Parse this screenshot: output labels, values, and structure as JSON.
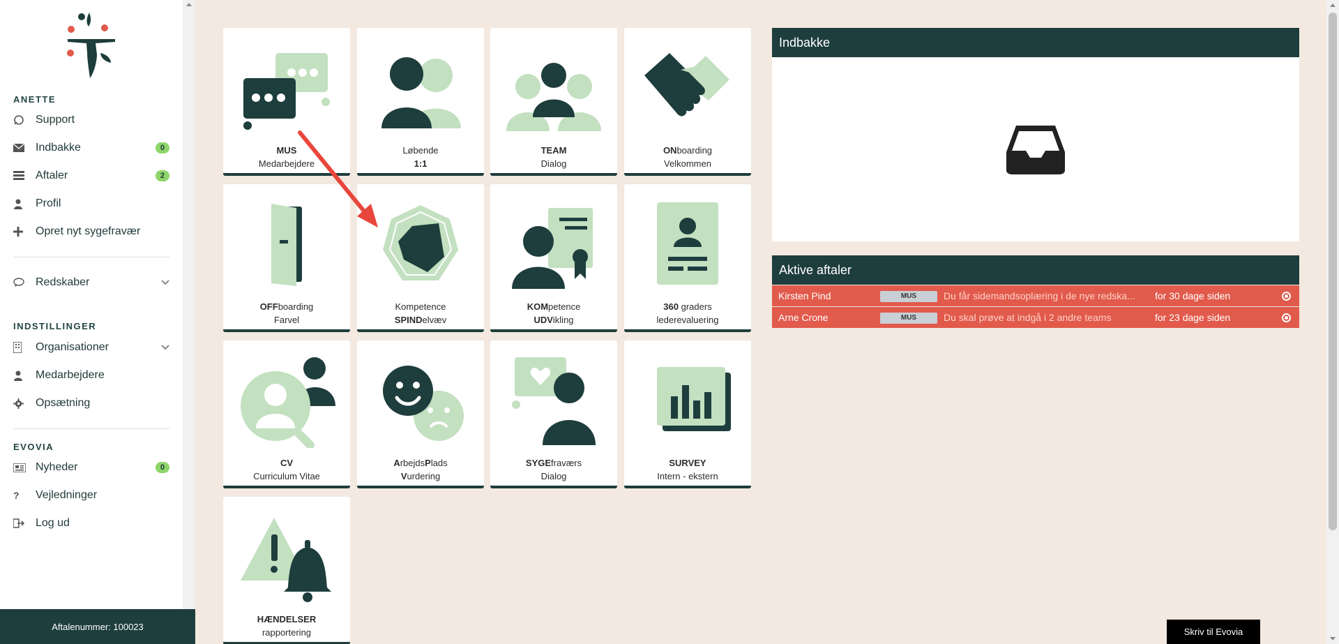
{
  "sidebar": {
    "user_section": "ANETTE",
    "items": [
      {
        "label": "Support",
        "icon": "support-icon"
      },
      {
        "label": "Indbakke",
        "icon": "envelope-icon",
        "badge": "0"
      },
      {
        "label": "Aftaler",
        "icon": "list-icon",
        "badge": "2"
      },
      {
        "label": "Profil",
        "icon": "user-icon"
      },
      {
        "label": "Opret nyt sygefravær",
        "icon": "plus-icon"
      }
    ],
    "tools": {
      "label": "Redskaber",
      "icon": "chat-bubble-icon"
    },
    "settings_section": "INDSTILLINGER",
    "settings_items": [
      {
        "label": "Organisationer",
        "icon": "building-icon"
      },
      {
        "label": "Medarbejdere",
        "icon": "user-icon"
      },
      {
        "label": "Opsætning",
        "icon": "gear-icon"
      }
    ],
    "evovia_section": "EVOVIA",
    "evovia_items": [
      {
        "label": "Nyheder",
        "icon": "newspaper-icon",
        "badge": "0"
      },
      {
        "label": "Vejledninger",
        "icon": "question-icon"
      },
      {
        "label": "Log ud",
        "icon": "logout-icon"
      }
    ],
    "footer": "Aftalenummer: 100023"
  },
  "tiles": [
    {
      "bold1": "MUS",
      "rest1": "",
      "bold2": "",
      "rest2": "Medarbejdere"
    },
    {
      "bold1": "",
      "rest1": "Løbende",
      "bold2": "1:1",
      "rest2": ""
    },
    {
      "bold1": "TEAM",
      "rest1": "",
      "bold2": "",
      "rest2": "Dialog"
    },
    {
      "bold1": "ON",
      "rest1": "boarding",
      "bold2": "",
      "rest2": "Velkommen"
    },
    {
      "bold1": "OFF",
      "rest1": "boarding",
      "bold2": "",
      "rest2": "Farvel"
    },
    {
      "bold1": "",
      "rest1": "Kompetence",
      "bold2": "SPIND",
      "rest2": "elvæv"
    },
    {
      "bold1": "KOM",
      "rest1": "petence",
      "bold2": "UDV",
      "rest2": "ikling"
    },
    {
      "bold1": "360",
      "rest1": " graders",
      "bold2": "",
      "rest2": "lederevaluering"
    },
    {
      "bold1": "CV",
      "rest1": "",
      "bold2": "",
      "rest2": "Curriculum Vitae"
    },
    {
      "line1_html_parts": [
        "A",
        "rbejds",
        "P",
        "lads"
      ],
      "bold2": "V",
      "rest2": "urdering"
    },
    {
      "bold1": "SYGE",
      "rest1": "fraværs",
      "bold2": "",
      "rest2": "Dialog"
    },
    {
      "bold1": "SURVEY",
      "rest1": "",
      "bold2": "",
      "rest2": "Intern - ekstern"
    },
    {
      "bold1": "HÆNDELSER",
      "rest1": "",
      "bold2": "",
      "rest2": "rapportering"
    }
  ],
  "inbox": {
    "title": "Indbakke"
  },
  "appointments": {
    "title": "Aktive aftaler",
    "rows": [
      {
        "name": "Kirsten Pind",
        "tag": "MUS",
        "desc": "Du får sidemandsoplæring i de nye redska...",
        "when": "for 30 dage siden"
      },
      {
        "name": "Arne Crone",
        "tag": "MUS",
        "desc": "Du skal prøve at indgå i 2 andre teams",
        "when": "for 23 dage siden"
      }
    ]
  },
  "write_button": "Skriv til Evovia",
  "colors": {
    "dark": "#1e3d3d",
    "light_green": "#c3e0c0",
    "accent_red": "#e15a4b",
    "badge_green": "#8ed56a",
    "background": "#f3e9e0"
  }
}
